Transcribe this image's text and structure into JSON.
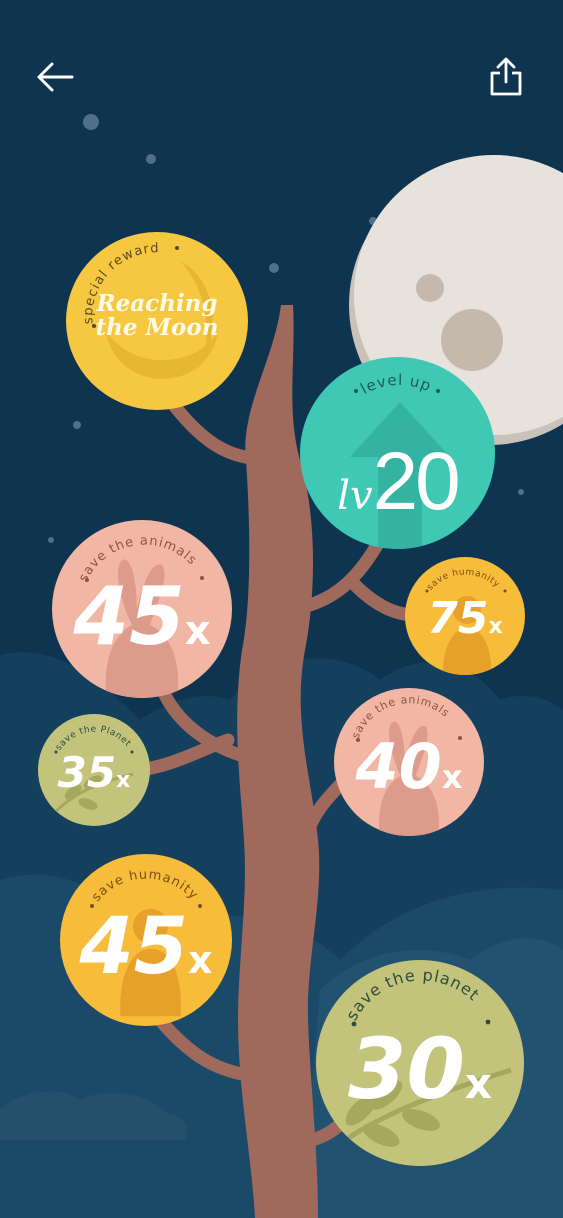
{
  "header": {
    "back_icon": "arrow-left-icon",
    "share_icon": "share-icon"
  },
  "colors": {
    "sky": "#0f3450",
    "moon": "#e6e1da",
    "trunk": "#9f6a5c",
    "yellow": "#f6c842",
    "teal": "#3fc8b4",
    "pink": "#f1b7a4",
    "green": "#c4c37c",
    "amber": "#f7bc3a"
  },
  "badges": {
    "moon": {
      "caption": "special reward",
      "line1": "Reaching",
      "line2": "the Moon"
    },
    "level": {
      "caption": "level up",
      "prefix": "lv",
      "value": "20"
    },
    "animals45": {
      "caption": "save the animals",
      "value": "45",
      "suffix": "x"
    },
    "humanity75": {
      "caption": "save humanity",
      "value": "75",
      "suffix": "x"
    },
    "planet35": {
      "caption": "save the Planet",
      "value": "35",
      "suffix": "x"
    },
    "animals40": {
      "caption": "save the animals",
      "value": "40",
      "suffix": "x"
    },
    "humanity45": {
      "caption": "save humanity",
      "value": "45",
      "suffix": "x"
    },
    "planet30": {
      "caption": "save the planet",
      "value": "30",
      "suffix": "x"
    }
  }
}
